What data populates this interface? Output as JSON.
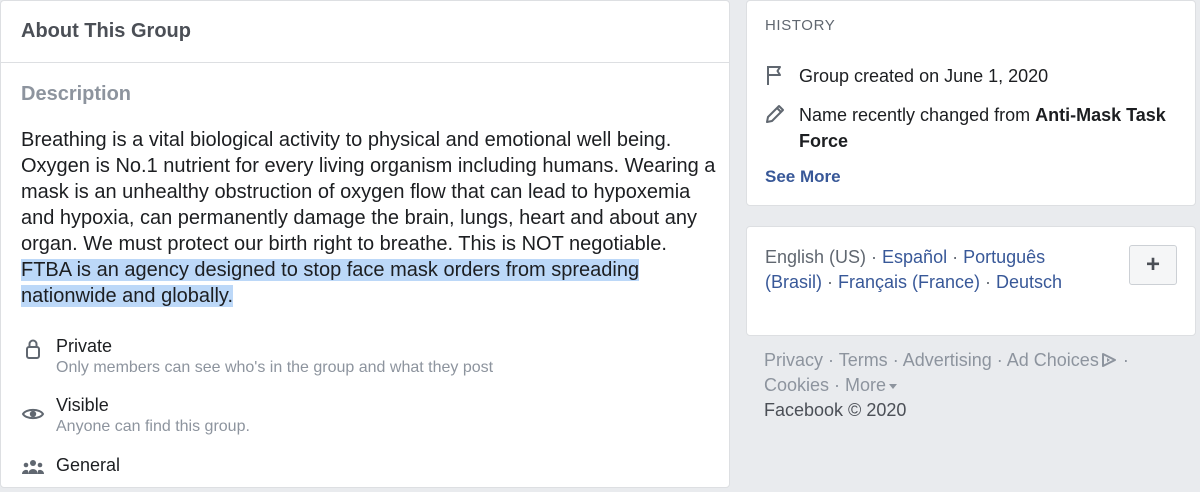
{
  "about": {
    "title": "About This Group",
    "description_heading": "Description",
    "description_text": "Breathing is a vital biological activity to physical and emotional well being. Oxygen is No.1 nutrient for every living organism including humans. Wearing a mask is an unhealthy obstruction of oxygen flow that can lead to hypoxemia and hypoxia, can permanently damage the brain, lungs, heart and about any organ. We must protect our birth right to breathe. This is NOT negotiable. ",
    "description_highlighted": "FTBA is an agency designed to stop face mask orders from spreading nationwide and globally.",
    "privacy": {
      "label": "Private",
      "detail": "Only members can see who's in the group and what they post",
      "icon": "lock-icon"
    },
    "visibility": {
      "label": "Visible",
      "detail": "Anyone can find this group.",
      "icon": "eye-icon"
    },
    "category": {
      "label": "General",
      "icon": "group-people-icon"
    }
  },
  "history": {
    "heading": "HISTORY",
    "created": {
      "text": "Group created on June 1, 2020",
      "icon": "flag-icon"
    },
    "name_change": {
      "prefix": "Name recently changed from ",
      "old_name": "Anti-Mask Task Force",
      "icon": "pencil-icon"
    },
    "see_more": "See More"
  },
  "languages": {
    "current": "English (US)",
    "separator": " · ",
    "options": [
      "Español",
      "Português (Brasil)",
      "Français (France)",
      "Deutsch"
    ],
    "add_button": "+"
  },
  "footer": {
    "links": [
      "Privacy",
      "Terms",
      "Advertising",
      "Ad Choices",
      "Cookies",
      "More"
    ],
    "copyright": "Facebook © 2020"
  },
  "colors": {
    "background": "#e9ebee",
    "link": "#385898",
    "highlight": "#bcd8f8",
    "muted": "#8d949e"
  }
}
